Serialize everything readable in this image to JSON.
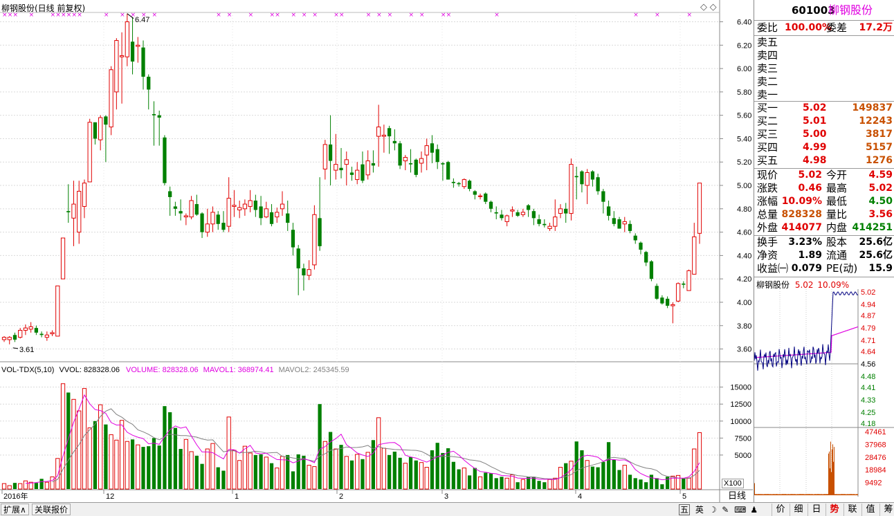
{
  "chart_header": {
    "title": "柳钢股份(日线 前复权)",
    "high_label": "6.47",
    "low_label": "3.61"
  },
  "price_axis": [
    "6.40",
    "6.20",
    "6.00",
    "5.80",
    "5.60",
    "5.40",
    "5.20",
    "5.00",
    "4.80",
    "4.60",
    "4.40",
    "4.20",
    "4.00",
    "3.80",
    "3.60"
  ],
  "vol_header": {
    "name": "VOL-TDX(5,10)",
    "vvol": "VVOL: 828328.06",
    "volume": "VOLUME: 828328.06",
    "mavol1": "MAVOL1: 368974.41",
    "mavol2": "MAVOL2: 245345.59"
  },
  "vol_axis": [
    "15000",
    "12500",
    "10000",
    "7500",
    "5000"
  ],
  "vol_unit": "X100",
  "date_labels": [
    "2016年",
    "12",
    "1",
    "2",
    "3",
    "4",
    "5"
  ],
  "period_label": "日线",
  "quote": {
    "code": "601003",
    "name": "柳钢股份",
    "weibi_label": "委比",
    "weibi": "100.00%",
    "weicha_label": "委差",
    "weicha": "17.2万",
    "sells": [
      {
        "label": "卖五"
      },
      {
        "label": "卖四"
      },
      {
        "label": "卖三"
      },
      {
        "label": "卖二"
      },
      {
        "label": "卖一"
      }
    ],
    "buys": [
      {
        "label": "买一",
        "price": "5.02",
        "vol": "149837"
      },
      {
        "label": "买二",
        "price": "5.01",
        "vol": "12243"
      },
      {
        "label": "买三",
        "price": "5.00",
        "vol": "3817"
      },
      {
        "label": "买四",
        "price": "4.99",
        "vol": "5157"
      },
      {
        "label": "买五",
        "price": "4.98",
        "vol": "1276"
      }
    ],
    "stats": [
      {
        "l1": "现价",
        "v1": "5.02",
        "l2": "今开",
        "v2": "4.59"
      },
      {
        "l1": "涨跌",
        "v1": "0.46",
        "l2": "最高",
        "v2": "5.02"
      },
      {
        "l1": "涨幅",
        "v1": "10.09%",
        "l2": "最低",
        "v2": "4.50"
      },
      {
        "l1": "总量",
        "v1": "828328",
        "l2": "量比",
        "v2": "3.56"
      },
      {
        "l1": "外盘",
        "v1": "414077",
        "l2": "内盘",
        "v2": "414251"
      }
    ],
    "fund": [
      {
        "l1": "换手",
        "v1": "3.23%",
        "l2": "股本",
        "v2": "25.6亿"
      },
      {
        "l1": "净资",
        "v1": "1.89",
        "l2": "流通",
        "v2": "25.6亿"
      },
      {
        "l1": "收益㈠",
        "v1": "0.079",
        "l2": "PE(动)",
        "v2": "15.9"
      }
    ]
  },
  "mini": {
    "name": "柳钢股份",
    "price": "5.02",
    "pct": "10.09%",
    "price_axis": [
      "5.02",
      "4.94",
      "4.87",
      "4.79",
      "4.71",
      "4.64",
      "4.56",
      "4.48",
      "4.41",
      "4.33",
      "4.25",
      "4.18"
    ],
    "vol_axis": [
      "47461",
      "37968",
      "28476",
      "18984",
      "9492"
    ]
  },
  "status": {
    "expand": "扩展∧",
    "related": "关联报价",
    "ime_items": [
      "五",
      "英",
      "☽",
      "✎",
      "⌨",
      "♟",
      "💬",
      "⚙"
    ],
    "tabs": [
      "价",
      "细",
      "日",
      "势",
      "联",
      "值",
      "筹"
    ]
  },
  "colors": {
    "up": "#e00000",
    "down": "#008000",
    "ma": "#e000e0",
    "ma2": "#808080"
  },
  "chart_data": {
    "type": "candlestick",
    "title": "柳钢股份(日线 前复权)",
    "x_labels": [
      "2016年",
      "12",
      "1",
      "2",
      "3",
      "4",
      "5"
    ],
    "y_range": [
      3.55,
      6.48
    ],
    "candles": [
      [
        3.68,
        3.7,
        3.66,
        3.71
      ],
      [
        3.68,
        3.7,
        3.64,
        3.71
      ],
      [
        3.72,
        3.68,
        3.66,
        3.74
      ],
      [
        3.7,
        3.76,
        3.69,
        3.78
      ],
      [
        3.76,
        3.78,
        3.72,
        3.81
      ],
      [
        3.77,
        3.79,
        3.74,
        3.83
      ],
      [
        3.78,
        3.74,
        3.72,
        3.8
      ],
      [
        3.73,
        3.72,
        3.7,
        3.75
      ],
      [
        3.7,
        3.72,
        3.67,
        3.75
      ],
      [
        3.73,
        3.74,
        3.71,
        3.76
      ],
      [
        3.71,
        4.14,
        3.71,
        4.14
      ],
      [
        4.2,
        4.55,
        4.2,
        4.55
      ],
      [
        4.78,
        4.77,
        4.68,
        5.01
      ],
      [
        4.72,
        4.84,
        4.48,
        5.04
      ],
      [
        4.6,
        4.95,
        4.5,
        5.04
      ],
      [
        4.82,
        5.02,
        4.72,
        5.05
      ],
      [
        5.03,
        5.54,
        5.03,
        5.57
      ],
      [
        5.54,
        5.4,
        5.35,
        5.54
      ],
      [
        5.39,
        5.58,
        5.3,
        5.6
      ],
      [
        5.59,
        5.52,
        5.2,
        5.6
      ],
      [
        5.5,
        5.99,
        5.43,
        6.02
      ],
      [
        5.8,
        6.24,
        5.65,
        6.26
      ],
      [
        6.1,
        6.11,
        5.7,
        6.31
      ],
      [
        6.1,
        6.4,
        6.02,
        6.47
      ],
      [
        6.23,
        6.06,
        5.95,
        6.44
      ],
      [
        6.19,
        6.2,
        6.05,
        6.27
      ],
      [
        6.18,
        5.93,
        5.82,
        6.24
      ],
      [
        5.93,
        5.82,
        5.65,
        5.95
      ],
      [
        5.61,
        5.6,
        5.34,
        5.72
      ],
      [
        5.6,
        5.58,
        5.34,
        5.64
      ],
      [
        5.41,
        5.02,
        5.0,
        5.43
      ],
      [
        4.95,
        4.9,
        4.74,
        4.99
      ],
      [
        4.82,
        4.8,
        4.74,
        4.86
      ],
      [
        4.78,
        4.76,
        4.7,
        4.88
      ],
      [
        4.73,
        4.74,
        4.66,
        4.76
      ],
      [
        4.73,
        4.87,
        4.71,
        4.91
      ],
      [
        4.84,
        4.75,
        4.74,
        4.92
      ],
      [
        4.76,
        4.6,
        4.55,
        4.77
      ],
      [
        4.6,
        4.67,
        4.56,
        4.8
      ],
      [
        4.67,
        4.77,
        4.6,
        4.82
      ],
      [
        4.75,
        4.67,
        4.62,
        4.78
      ],
      [
        4.68,
        4.62,
        4.6,
        4.78
      ],
      [
        4.65,
        4.89,
        4.6,
        5.07
      ],
      [
        4.82,
        4.83,
        4.73,
        4.96
      ],
      [
        4.79,
        4.81,
        4.72,
        4.87
      ],
      [
        4.8,
        4.84,
        4.74,
        4.88
      ],
      [
        4.82,
        4.87,
        4.77,
        4.96
      ],
      [
        4.87,
        4.79,
        4.73,
        4.92
      ],
      [
        4.82,
        4.72,
        4.66,
        4.91
      ],
      [
        4.73,
        4.8,
        4.72,
        4.86
      ],
      [
        4.77,
        4.67,
        4.65,
        4.84
      ],
      [
        4.73,
        4.77,
        4.68,
        4.81
      ],
      [
        4.8,
        4.84,
        4.74,
        4.95
      ],
      [
        4.76,
        4.68,
        4.61,
        4.87
      ],
      [
        4.62,
        4.47,
        4.4,
        4.68
      ],
      [
        4.46,
        4.29,
        4.06,
        4.49
      ],
      [
        4.29,
        4.23,
        4.1,
        4.33
      ],
      [
        4.23,
        4.28,
        4.19,
        4.36
      ],
      [
        4.32,
        4.75,
        4.28,
        4.83
      ],
      [
        4.72,
        4.48,
        4.44,
        5.07
      ],
      [
        5.14,
        5.35,
        5.05,
        5.39
      ],
      [
        5.35,
        5.21,
        5.0,
        5.6
      ],
      [
        5.13,
        5.18,
        5.05,
        5.44
      ],
      [
        5.15,
        5.13,
        5.06,
        5.32
      ],
      [
        5.18,
        5.22,
        5.0,
        5.29
      ],
      [
        5.11,
        5.09,
        5.04,
        5.16
      ],
      [
        5.05,
        5.13,
        5.01,
        5.2
      ],
      [
        5.18,
        5.04,
        5.02,
        5.29
      ],
      [
        5.09,
        5.21,
        5.05,
        5.3
      ],
      [
        5.19,
        5.17,
        5.11,
        5.3
      ],
      [
        5.42,
        5.5,
        5.16,
        5.69
      ],
      [
        5.42,
        5.43,
        5.28,
        5.52
      ],
      [
        5.49,
        5.42,
        5.27,
        5.51
      ],
      [
        5.38,
        5.36,
        5.3,
        5.48
      ],
      [
        5.36,
        5.17,
        5.14,
        5.38
      ],
      [
        5.21,
        5.24,
        5.13,
        5.26
      ],
      [
        5.19,
        5.18,
        5.11,
        5.31
      ],
      [
        5.22,
        5.09,
        5.07,
        5.23
      ],
      [
        5.19,
        5.23,
        5.11,
        5.29
      ],
      [
        5.26,
        5.34,
        5.13,
        5.4
      ],
      [
        5.36,
        5.28,
        5.19,
        5.43
      ],
      [
        5.31,
        5.2,
        5.14,
        5.35
      ],
      [
        5.19,
        5.18,
        5.04,
        5.2
      ],
      [
        5.2,
        5.05,
        5.05,
        5.21
      ],
      [
        5.03,
        5.02,
        4.98,
        5.06
      ],
      [
        5.02,
        5.01,
        4.99,
        5.03
      ],
      [
        4.99,
        5.05,
        4.97,
        5.06
      ],
      [
        5.04,
        4.97,
        4.95,
        5.05
      ],
      [
        4.95,
        4.92,
        4.88,
        4.96
      ],
      [
        4.91,
        4.91,
        4.88,
        4.93
      ],
      [
        4.93,
        4.86,
        4.84,
        4.94
      ],
      [
        4.86,
        4.8,
        4.77,
        4.87
      ],
      [
        4.77,
        4.76,
        4.71,
        4.82
      ],
      [
        4.75,
        4.72,
        4.7,
        4.79
      ],
      [
        4.69,
        4.74,
        4.65,
        4.75
      ],
      [
        4.78,
        4.79,
        4.73,
        4.82
      ],
      [
        4.77,
        4.74,
        4.73,
        4.79
      ],
      [
        4.75,
        4.77,
        4.73,
        4.8
      ],
      [
        4.83,
        4.79,
        4.73,
        4.84
      ],
      [
        4.78,
        4.72,
        4.66,
        4.8
      ],
      [
        4.71,
        4.67,
        4.65,
        4.75
      ],
      [
        4.67,
        4.66,
        4.64,
        4.71
      ],
      [
        4.63,
        4.65,
        4.61,
        4.68
      ],
      [
        4.65,
        4.73,
        4.61,
        4.88
      ],
      [
        4.76,
        4.8,
        4.72,
        4.84
      ],
      [
        4.8,
        4.76,
        4.68,
        4.85
      ],
      [
        4.76,
        5.18,
        4.7,
        5.23
      ],
      [
        5.08,
        5.07,
        4.88,
        5.16
      ],
      [
        5.12,
        5.01,
        4.94,
        5.13
      ],
      [
        5.0,
        5.11,
        4.84,
        5.14
      ],
      [
        5.12,
        5.05,
        4.99,
        5.13
      ],
      [
        5.07,
        4.95,
        4.92,
        5.1
      ],
      [
        4.95,
        4.86,
        4.76,
        4.97
      ],
      [
        4.82,
        4.74,
        4.7,
        4.87
      ],
      [
        4.72,
        4.67,
        4.65,
        4.78
      ],
      [
        4.71,
        4.63,
        4.63,
        4.73
      ],
      [
        4.67,
        4.69,
        4.6,
        4.73
      ],
      [
        4.67,
        4.61,
        4.59,
        4.7
      ],
      [
        4.57,
        4.53,
        4.5,
        4.59
      ],
      [
        4.51,
        4.45,
        4.41,
        4.52
      ],
      [
        4.43,
        4.34,
        4.31,
        4.44
      ],
      [
        4.35,
        4.2,
        4.18,
        4.36
      ],
      [
        4.14,
        4.03,
        4.02,
        4.16
      ],
      [
        4.04,
        3.99,
        3.98,
        4.06
      ],
      [
        4.03,
        3.97,
        3.95,
        4.05
      ],
      [
        3.97,
        3.98,
        3.82,
        4.0
      ],
      [
        4.01,
        4.16,
        4.0,
        4.17
      ],
      [
        4.16,
        4.15,
        4.12,
        4.18
      ],
      [
        4.1,
        4.27,
        4.1,
        4.28
      ],
      [
        4.24,
        4.56,
        4.24,
        4.68
      ],
      [
        4.59,
        5.02,
        4.5,
        5.02
      ]
    ],
    "candle_format": [
      "open",
      "close",
      "low",
      "high"
    ],
    "volume_series": [
      {
        "name": "VOLUME",
        "values": [
          800,
          500,
          900,
          800,
          1200,
          1000,
          900,
          1500,
          1000,
          1800,
          4500,
          15500,
          14200,
          13200,
          11500,
          14800,
          9000,
          10000,
          12400,
          9500,
          8000,
          7200,
          10100,
          7000,
          7300,
          6500,
          6200,
          6300,
          7500,
          6400,
          12200,
          11300,
          9000,
          5900,
          7300,
          5500,
          4900,
          3700,
          5900,
          6700,
          3200,
          2700,
          10600,
          5700,
          4200,
          6300,
          5300,
          5000,
          5100,
          4700,
          3800,
          3100,
          4800,
          5000,
          2600,
          5100,
          4900,
          3500,
          3300,
          12500,
          7000,
          8400,
          5900,
          6500,
          4800,
          4200,
          5100,
          4400,
          5400,
          7200,
          10500,
          6000,
          5000,
          5500,
          4600,
          3800,
          4700,
          4200,
          3900,
          3200,
          5700,
          6800,
          5300,
          6000,
          4000,
          2900,
          3100,
          2000,
          3100,
          1800,
          2400,
          2300,
          1600,
          1800,
          1600,
          2100,
          1000,
          1400,
          1800,
          1800,
          1200,
          1000,
          1400,
          1600,
          3200,
          3800,
          4100,
          7000,
          5700,
          4200,
          3300,
          3200,
          4000,
          6900,
          4300,
          2800,
          3500,
          2100,
          1600,
          1400,
          1000,
          2100,
          1600,
          700,
          1800,
          1900,
          2000,
          1600,
          1600,
          5900,
          8300
        ]
      },
      {
        "name": "MAVOL1",
        "values": []
      },
      {
        "name": "MAVOL2",
        "values": []
      }
    ],
    "volume_ylim": [
      0,
      17000
    ]
  }
}
